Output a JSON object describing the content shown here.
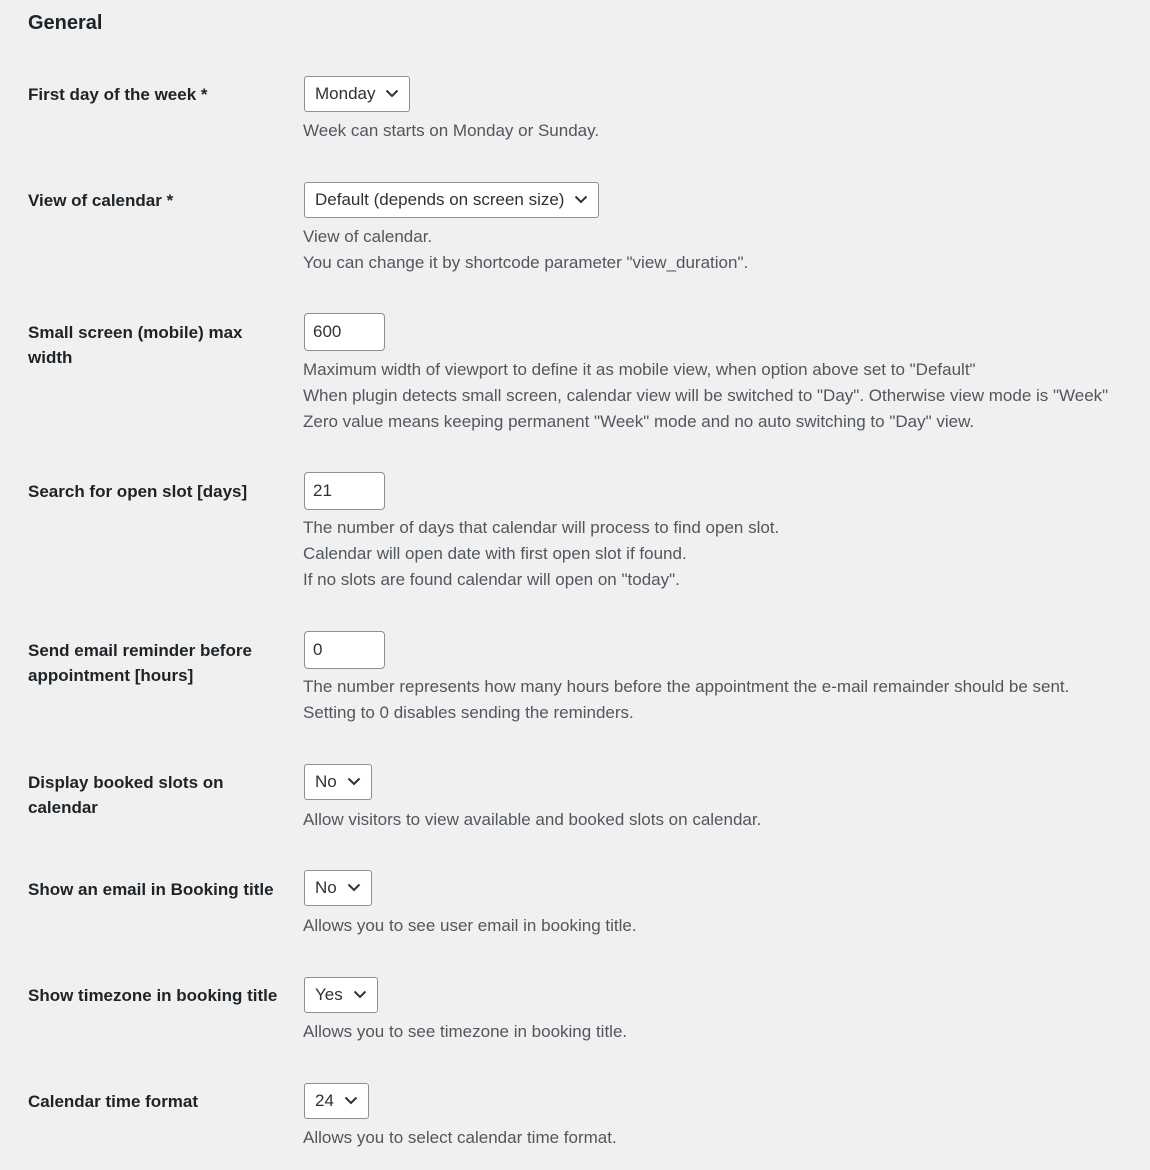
{
  "section": {
    "title": "General"
  },
  "settings": {
    "first_day": {
      "label": "First day of the week *",
      "value": "Monday",
      "desc": [
        "Week can starts on Monday or Sunday."
      ]
    },
    "calendar_view": {
      "label": "View of calendar *",
      "value": "Default (depends on screen size)",
      "desc": [
        "View of calendar.",
        "You can change it by shortcode parameter \"view_duration\"."
      ]
    },
    "mobile_width": {
      "label": "Small screen (mobile) max width",
      "value": "600",
      "desc": [
        "Maximum width of viewport to define it as mobile view, when option above set to \"Default\"",
        "When plugin detects small screen, calendar view will be switched to \"Day\". Otherwise view mode is \"Week\"",
        "Zero value means keeping permanent \"Week\" mode and no auto switching to \"Day\" view."
      ]
    },
    "search_days": {
      "label": "Search for open slot [days]",
      "value": "21",
      "desc": [
        "The number of days that calendar will process to find open slot.",
        "Calendar will open date with first open slot if found.",
        "If no slots are found calendar will open on \"today\"."
      ]
    },
    "reminder_hours": {
      "label": "Send email reminder before appointment [hours]",
      "value": "0",
      "desc": [
        "The number represents how many hours before the appointment the e-mail remainder should be sent.",
        "Setting to 0 disables sending the reminders."
      ]
    },
    "booked_slots": {
      "label": "Display booked slots on calendar",
      "value": "No",
      "desc": [
        "Allow visitors to view available and booked slots on calendar."
      ]
    },
    "email_title": {
      "label": "Show an email in Booking title",
      "value": "No",
      "desc": [
        "Allows you to see user email in booking title."
      ]
    },
    "timezone_title": {
      "label": "Show timezone in booking title",
      "value": "Yes",
      "desc": [
        "Allows you to see timezone in booking title."
      ]
    },
    "time_format": {
      "label": "Calendar time format",
      "value": "24",
      "desc": [
        "Allows you to select calendar time format."
      ]
    }
  }
}
